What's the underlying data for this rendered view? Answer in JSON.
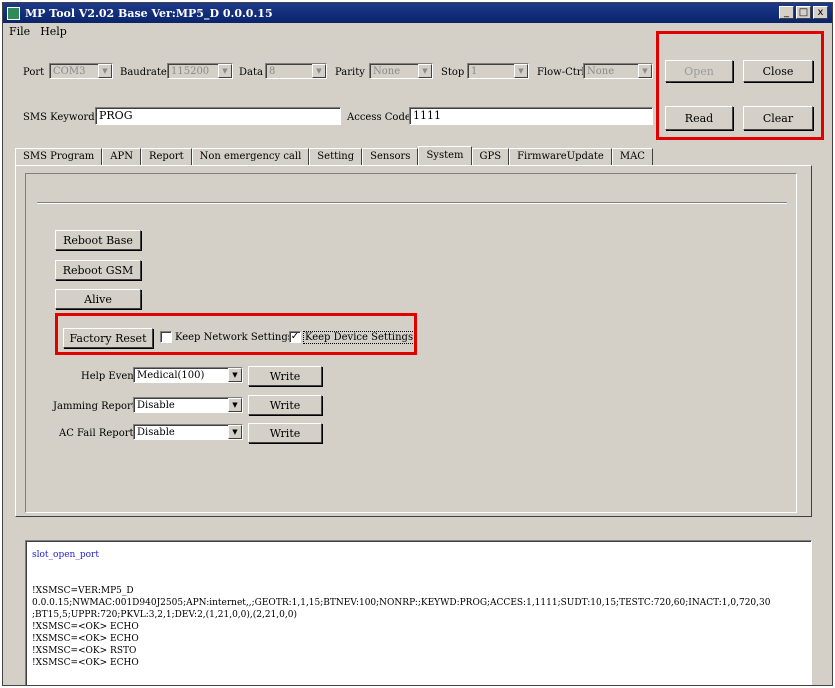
{
  "window": {
    "title": "MP Tool V2.02  Base Ver:MP5_D 0.0.0.15",
    "controls": [
      "_",
      "□",
      "x"
    ]
  },
  "menu": [
    "File",
    "Help"
  ],
  "serial": {
    "port_label": "Port",
    "port_value": "COM3",
    "baud_label": "Baudrate",
    "baud_value": "115200",
    "data_label": "Data",
    "data_value": "8",
    "parity_label": "Parity",
    "parity_value": "None",
    "stop_label": "Stop",
    "stop_value": "1",
    "flow_label": "Flow-Ctrl",
    "flow_value": "None"
  },
  "buttons": {
    "open": "Open",
    "close": "Close",
    "read": "Read",
    "clear": "Clear"
  },
  "sms": {
    "keyword_label": "SMS Keyword",
    "keyword_value": "PROG",
    "access_label": "Access Code",
    "access_value": "1111"
  },
  "tabs": [
    "SMS Program",
    "APN",
    "Report",
    "Non emergency call",
    "Setting",
    "Sensors",
    "System",
    "GPS",
    "FirmwareUpdate",
    "MAC"
  ],
  "active_tab": "System",
  "system": {
    "reboot_base": "Reboot Base",
    "reboot_gsm": "Reboot GSM",
    "alive": "Alive",
    "factory_reset": "Factory Reset",
    "keep_network": {
      "label": "Keep Network Settings",
      "checked": false
    },
    "keep_device": {
      "label": "Keep Device Settings",
      "checked": true
    },
    "rows": [
      {
        "label": "Help Event",
        "value": "Medical(100)",
        "button": "Write"
      },
      {
        "label": "Jamming Report",
        "value": "Disable",
        "button": "Write"
      },
      {
        "label": "AC Fail Report",
        "value": "Disable",
        "button": "Write"
      }
    ]
  },
  "log": {
    "lines": [
      "slot_open_port",
      "",
      "",
      "!XSMSC=VER:MP5_D",
      "0.0.0.15;NWMAC:001D940J2505;APN:internet,,;GEOTR:1,1,15;BTNEV:100;NONRP:;KEYWD:PROG;ACCES:1,1111;SUDT:10,15;TESTC:720,60;INACT:1,0,720,30",
      ";BT15,5;UPPR:720;PKVL:3,2,1;DEV:2,(1,21,0,0),(2,21,0,0)",
      "!XSMSC=<OK> ECHO",
      "!XSMSC=<OK> ECHO",
      "!XSMSC=<OK> RSTO",
      "!XSMSC=<OK> ECHO"
    ]
  }
}
